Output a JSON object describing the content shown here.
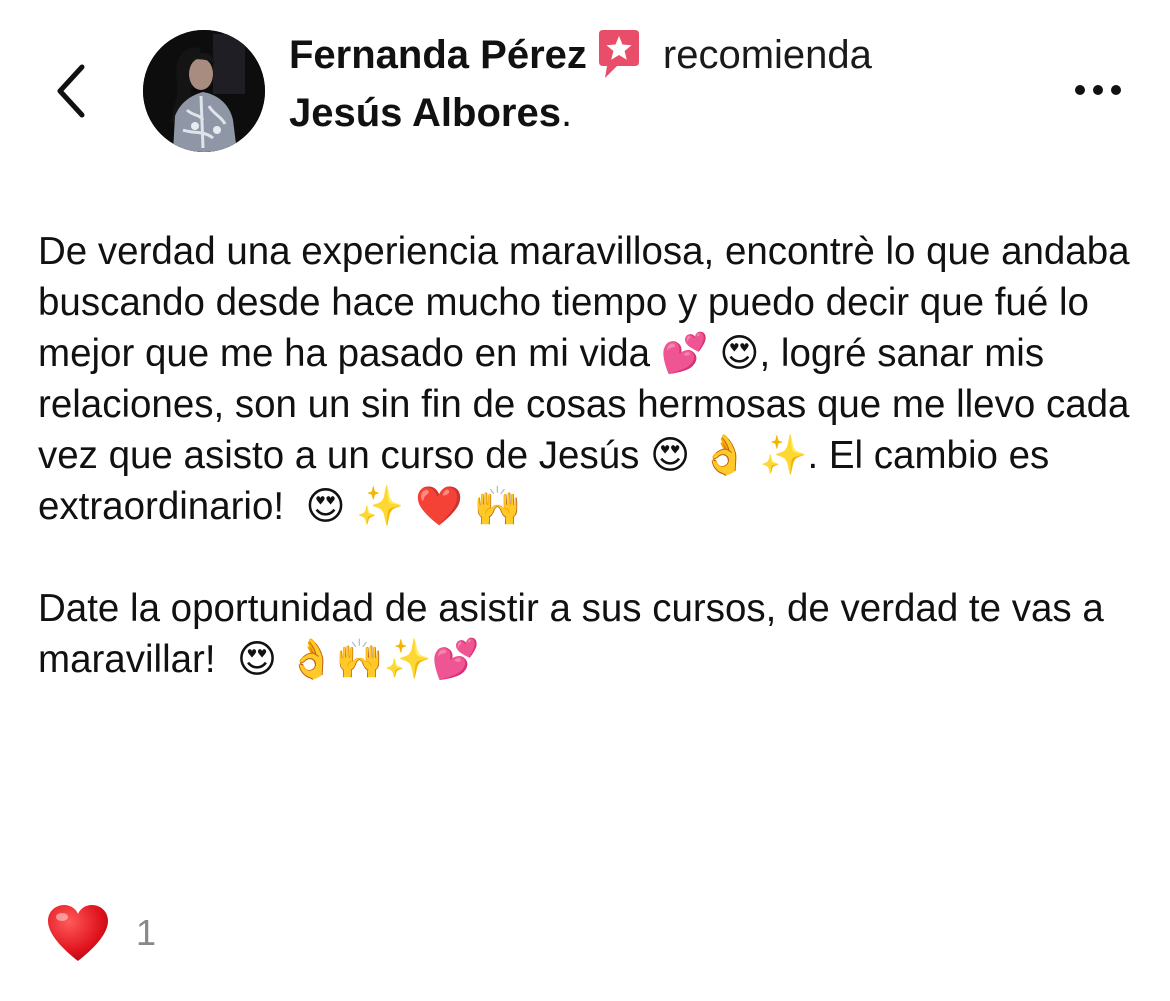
{
  "header": {
    "back_icon": "chevron-left-icon",
    "author_name": "Fernanda Pérez",
    "badge_icon": "star-speech-bubble-icon",
    "badge_color": "#e84e6a",
    "action_text": "recomienda",
    "target_name": "Jesús Albores",
    "target_suffix": ".",
    "more_icon": "more-horizontal-icon"
  },
  "review": {
    "paragraphs": [
      "De verdad una experiencia maravillosa, encontrè lo que andaba buscando desde hace mucho tiempo y puedo decir que fué lo mejor que me ha pasado en mi vida 💕 😍, logré sanar mis relaciones, son un sin fin de cosas hermosas que me llevo cada vez que asisto a un curso de Jesús 😍 👌 ✨. El cambio es extraordinario!  😍 ✨ ❤️ 🙌",
      "Date la oportunidad de asistir a sus cursos, de verdad te vas a maravillar!  😍 👌🙌✨💕"
    ]
  },
  "reactions": {
    "icon": "red-heart-icon",
    "glyph": "❤️",
    "count": "1"
  }
}
